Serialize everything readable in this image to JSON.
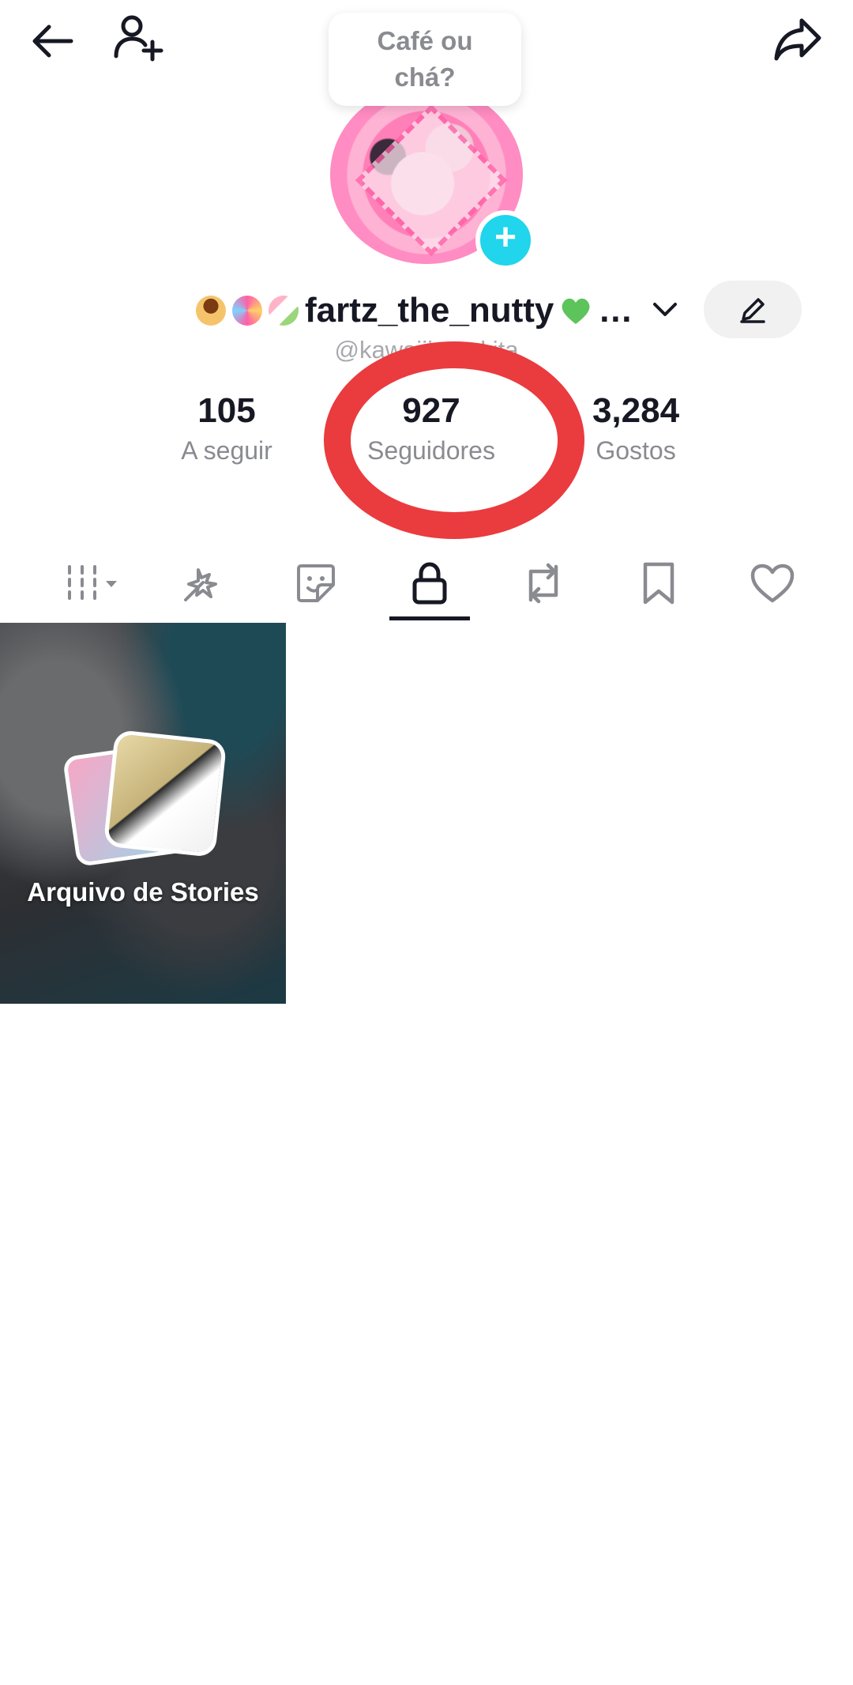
{
  "top_bar": {
    "back_icon": "arrow-left-icon",
    "add_friend_icon": "person-add-icon",
    "share_icon": "share-arrow-icon"
  },
  "note": {
    "text": "Café ou chá?"
  },
  "profile": {
    "username": "fartz_the_nutty",
    "username_suffix": "…",
    "handle": "@kawaiiiresukita",
    "edit_icon": "pencil-icon",
    "avatar_add_label": "+"
  },
  "stats": {
    "following": {
      "value": "105",
      "label": "A seguir"
    },
    "followers": {
      "value": "927",
      "label": "Seguidores"
    },
    "likes": {
      "value": "3,284",
      "label": "Gostos"
    }
  },
  "annotation": {
    "color": "#ea3b3f"
  },
  "tabs": [
    {
      "icon": "grid-dropdown-icon"
    },
    {
      "icon": "sparkle-icon"
    },
    {
      "icon": "sticker-icon"
    },
    {
      "icon": "lock-icon",
      "active": true
    },
    {
      "icon": "repost-icon"
    },
    {
      "icon": "bookmark-icon"
    },
    {
      "icon": "heart-icon"
    }
  ],
  "grid": {
    "items": [
      {
        "label": "Arquivo de Stories"
      }
    ]
  },
  "colors": {
    "accent_cyan": "#20d5ec",
    "text_primary": "#161823",
    "text_secondary": "#8a8b91"
  }
}
